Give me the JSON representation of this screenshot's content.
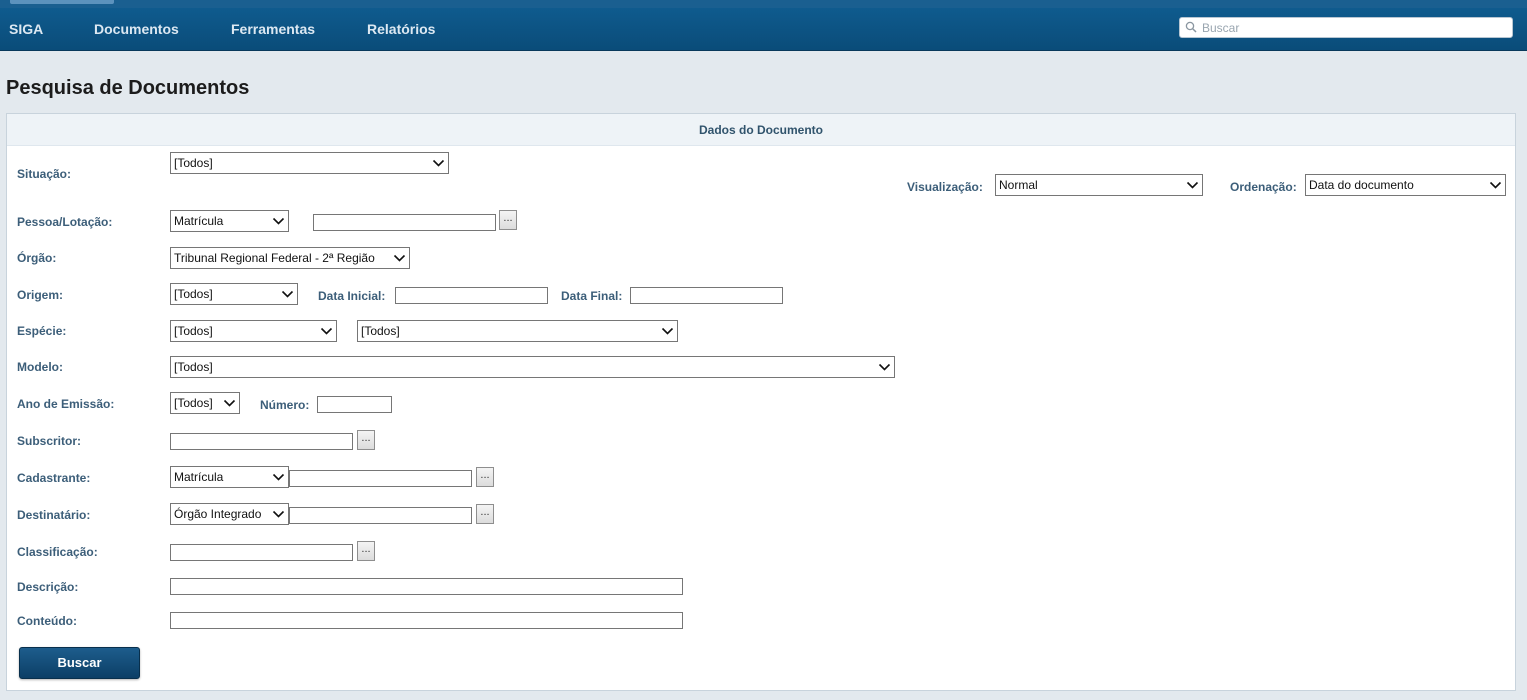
{
  "nav": {
    "items": [
      "SIGA",
      "Documentos",
      "Ferramentas",
      "Relatórios"
    ],
    "search_placeholder": "Buscar"
  },
  "page_title": "Pesquisa de Documentos",
  "panel_title": "Dados do Documento",
  "form": {
    "situacao": {
      "label": "Situação:",
      "value": "[Todos]"
    },
    "visualizacao": {
      "label": "Visualização:",
      "value": "Normal"
    },
    "ordenacao": {
      "label": "Ordenação:",
      "value": "Data do documento"
    },
    "pessoa_lotacao": {
      "label": "Pessoa/Lotação:",
      "type_value": "Matrícula",
      "text_value": ""
    },
    "orgao": {
      "label": "Órgão:",
      "value": "Tribunal Regional Federal - 2ª Região"
    },
    "origem": {
      "label": "Origem:",
      "value": "[Todos]"
    },
    "data_inicial": {
      "label": "Data Inicial:",
      "value": ""
    },
    "data_final": {
      "label": "Data Final:",
      "value": ""
    },
    "especie": {
      "label": "Espécie:",
      "value1": "[Todos]",
      "value2": "[Todos]"
    },
    "modelo": {
      "label": "Modelo:",
      "value": "[Todos]"
    },
    "ano_emissao": {
      "label": "Ano de Emissão:",
      "value": "[Todos]"
    },
    "numero": {
      "label": "Número:",
      "value": ""
    },
    "subscritor": {
      "label": "Subscritor:",
      "value": ""
    },
    "cadastrante": {
      "label": "Cadastrante:",
      "type_value": "Matrícula",
      "text_value": ""
    },
    "destinatario": {
      "label": "Destinatário:",
      "type_value": "Órgão Integrado",
      "text_value": ""
    },
    "classificacao": {
      "label": "Classificação:",
      "value": ""
    },
    "descricao": {
      "label": "Descrição:",
      "value": ""
    },
    "conteudo": {
      "label": "Conteúdo:",
      "value": ""
    },
    "lookup_button_label": "...",
    "submit_label": "Buscar"
  },
  "icons": {
    "search": "search-icon",
    "dropdown": "chevron-down-icon"
  },
  "colors": {
    "nav_bg": "#0f5b8e",
    "label": "#3c5e79",
    "button_bg": "#1d5d8c"
  }
}
